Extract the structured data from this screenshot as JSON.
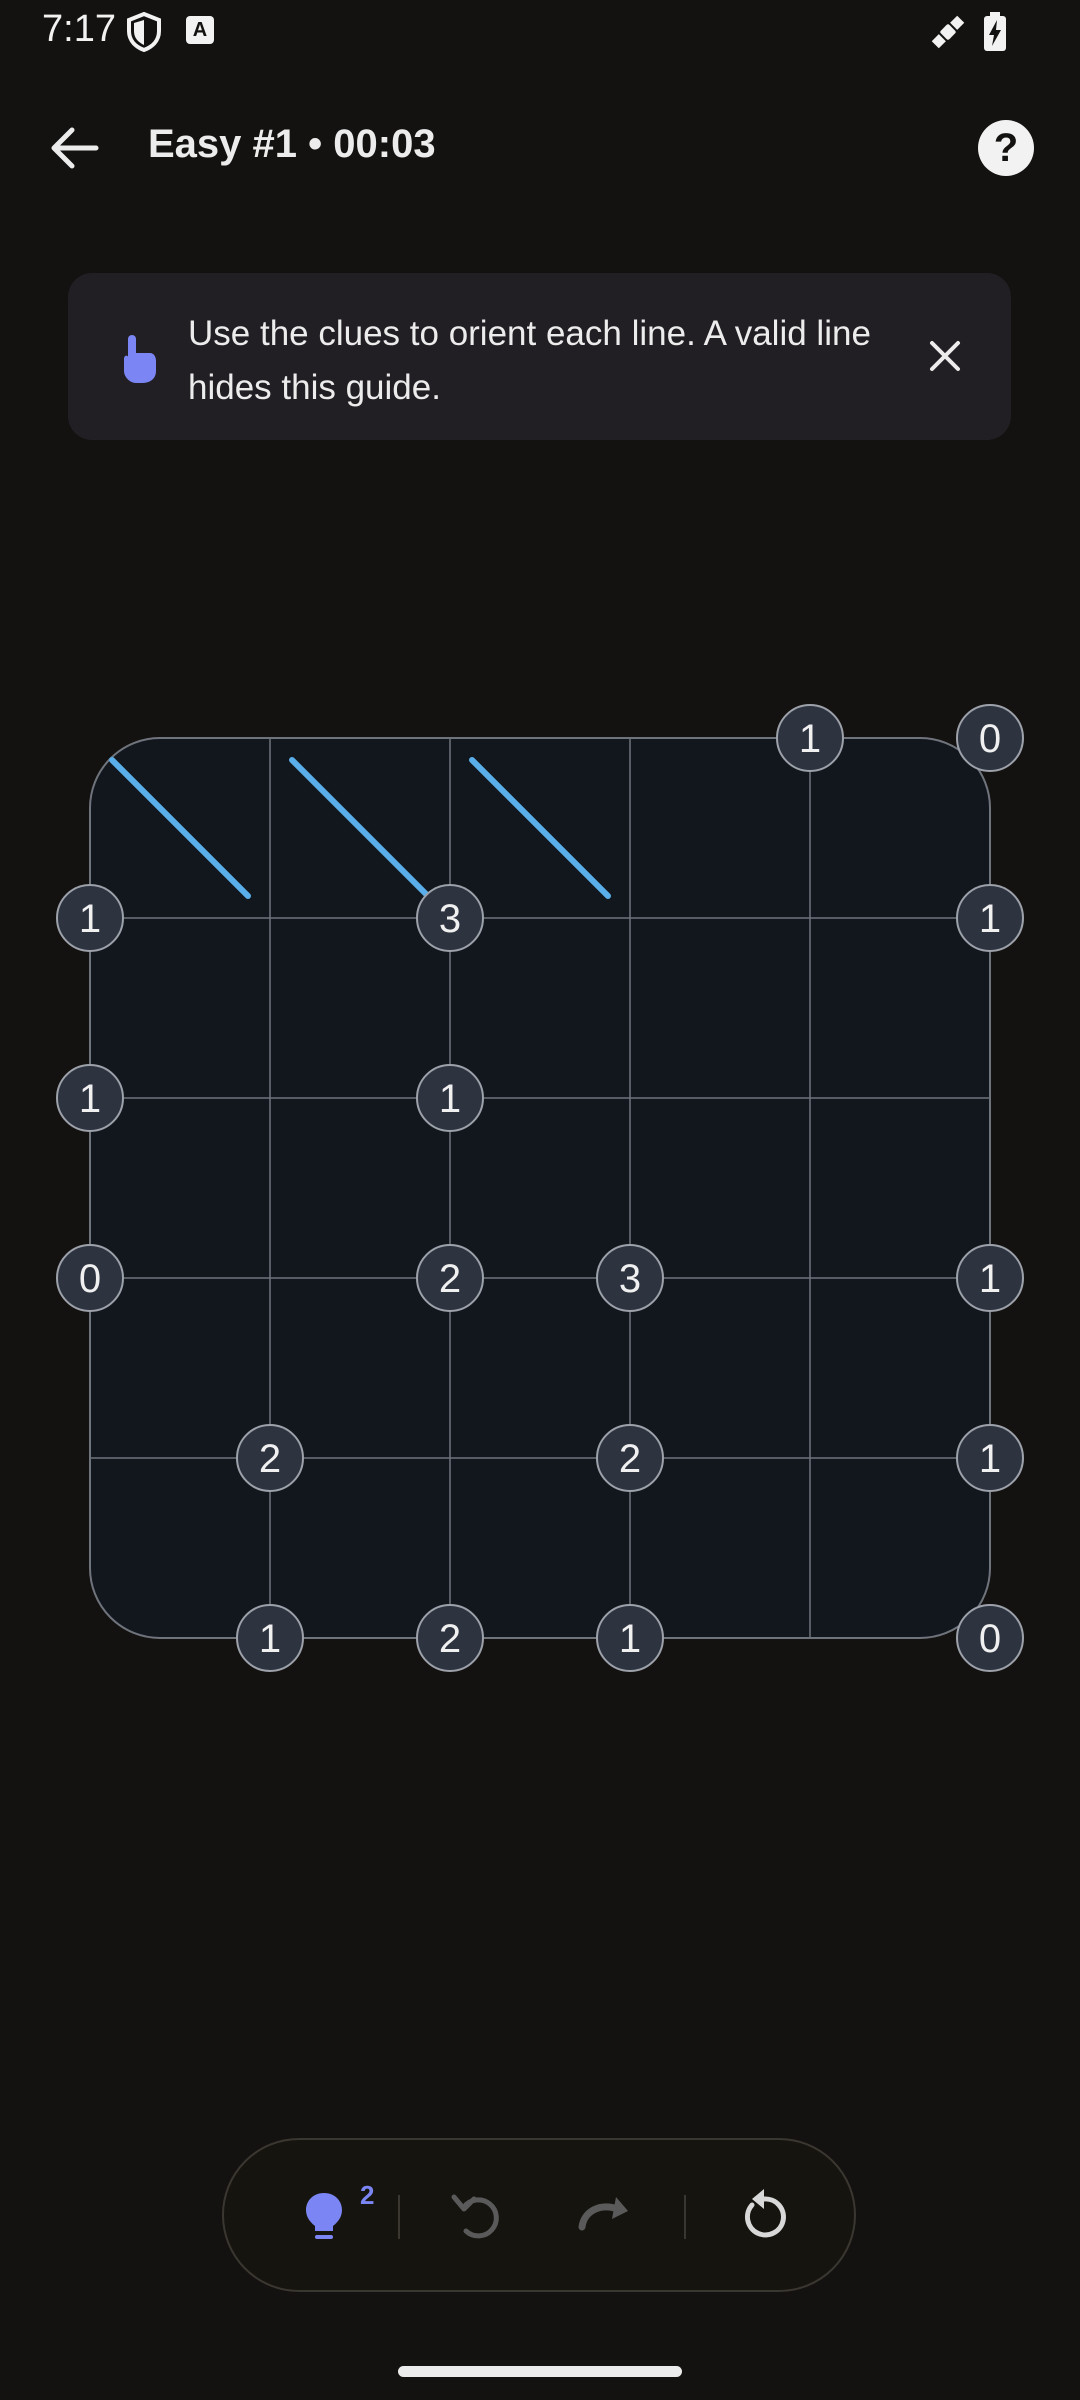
{
  "status": {
    "time": "7:17",
    "a_glyph": "A"
  },
  "header": {
    "title": "Easy #1 • 00:03",
    "help_glyph": "?"
  },
  "guide": {
    "text": "Use the clues to orient each line. A valid line hides this guide."
  },
  "puzzle": {
    "rows": 5,
    "cols": 5,
    "clues": [
      {
        "r": 0,
        "c": 4,
        "value": "1"
      },
      {
        "r": 0,
        "c": 5,
        "value": "0"
      },
      {
        "r": 1,
        "c": 0,
        "value": "1"
      },
      {
        "r": 1,
        "c": 2,
        "value": "3"
      },
      {
        "r": 1,
        "c": 5,
        "value": "1"
      },
      {
        "r": 2,
        "c": 0,
        "value": "1"
      },
      {
        "r": 2,
        "c": 2,
        "value": "1"
      },
      {
        "r": 3,
        "c": 0,
        "value": "0"
      },
      {
        "r": 3,
        "c": 2,
        "value": "2"
      },
      {
        "r": 3,
        "c": 3,
        "value": "3"
      },
      {
        "r": 3,
        "c": 5,
        "value": "1"
      },
      {
        "r": 4,
        "c": 1,
        "value": "2"
      },
      {
        "r": 4,
        "c": 3,
        "value": "2"
      },
      {
        "r": 4,
        "c": 5,
        "value": "1"
      },
      {
        "r": 5,
        "c": 1,
        "value": "1"
      },
      {
        "r": 5,
        "c": 2,
        "value": "2"
      },
      {
        "r": 5,
        "c": 3,
        "value": "1"
      },
      {
        "r": 5,
        "c": 5,
        "value": "0"
      }
    ],
    "lines": [
      {
        "r": 0,
        "c": 0,
        "dir": "backslash"
      },
      {
        "r": 0,
        "c": 1,
        "dir": "backslash"
      },
      {
        "r": 0,
        "c": 2,
        "dir": "backslash"
      }
    ],
    "colors": {
      "line": "#5AAFEA",
      "cell": "#12171E",
      "grid": "#6F737C",
      "clue_fill": "#2D3440",
      "clue_border": "#9CA1AA"
    }
  },
  "toolbar": {
    "hint_count": "2"
  },
  "colors": {
    "accent": "#7B86F4",
    "background": "#141210"
  }
}
